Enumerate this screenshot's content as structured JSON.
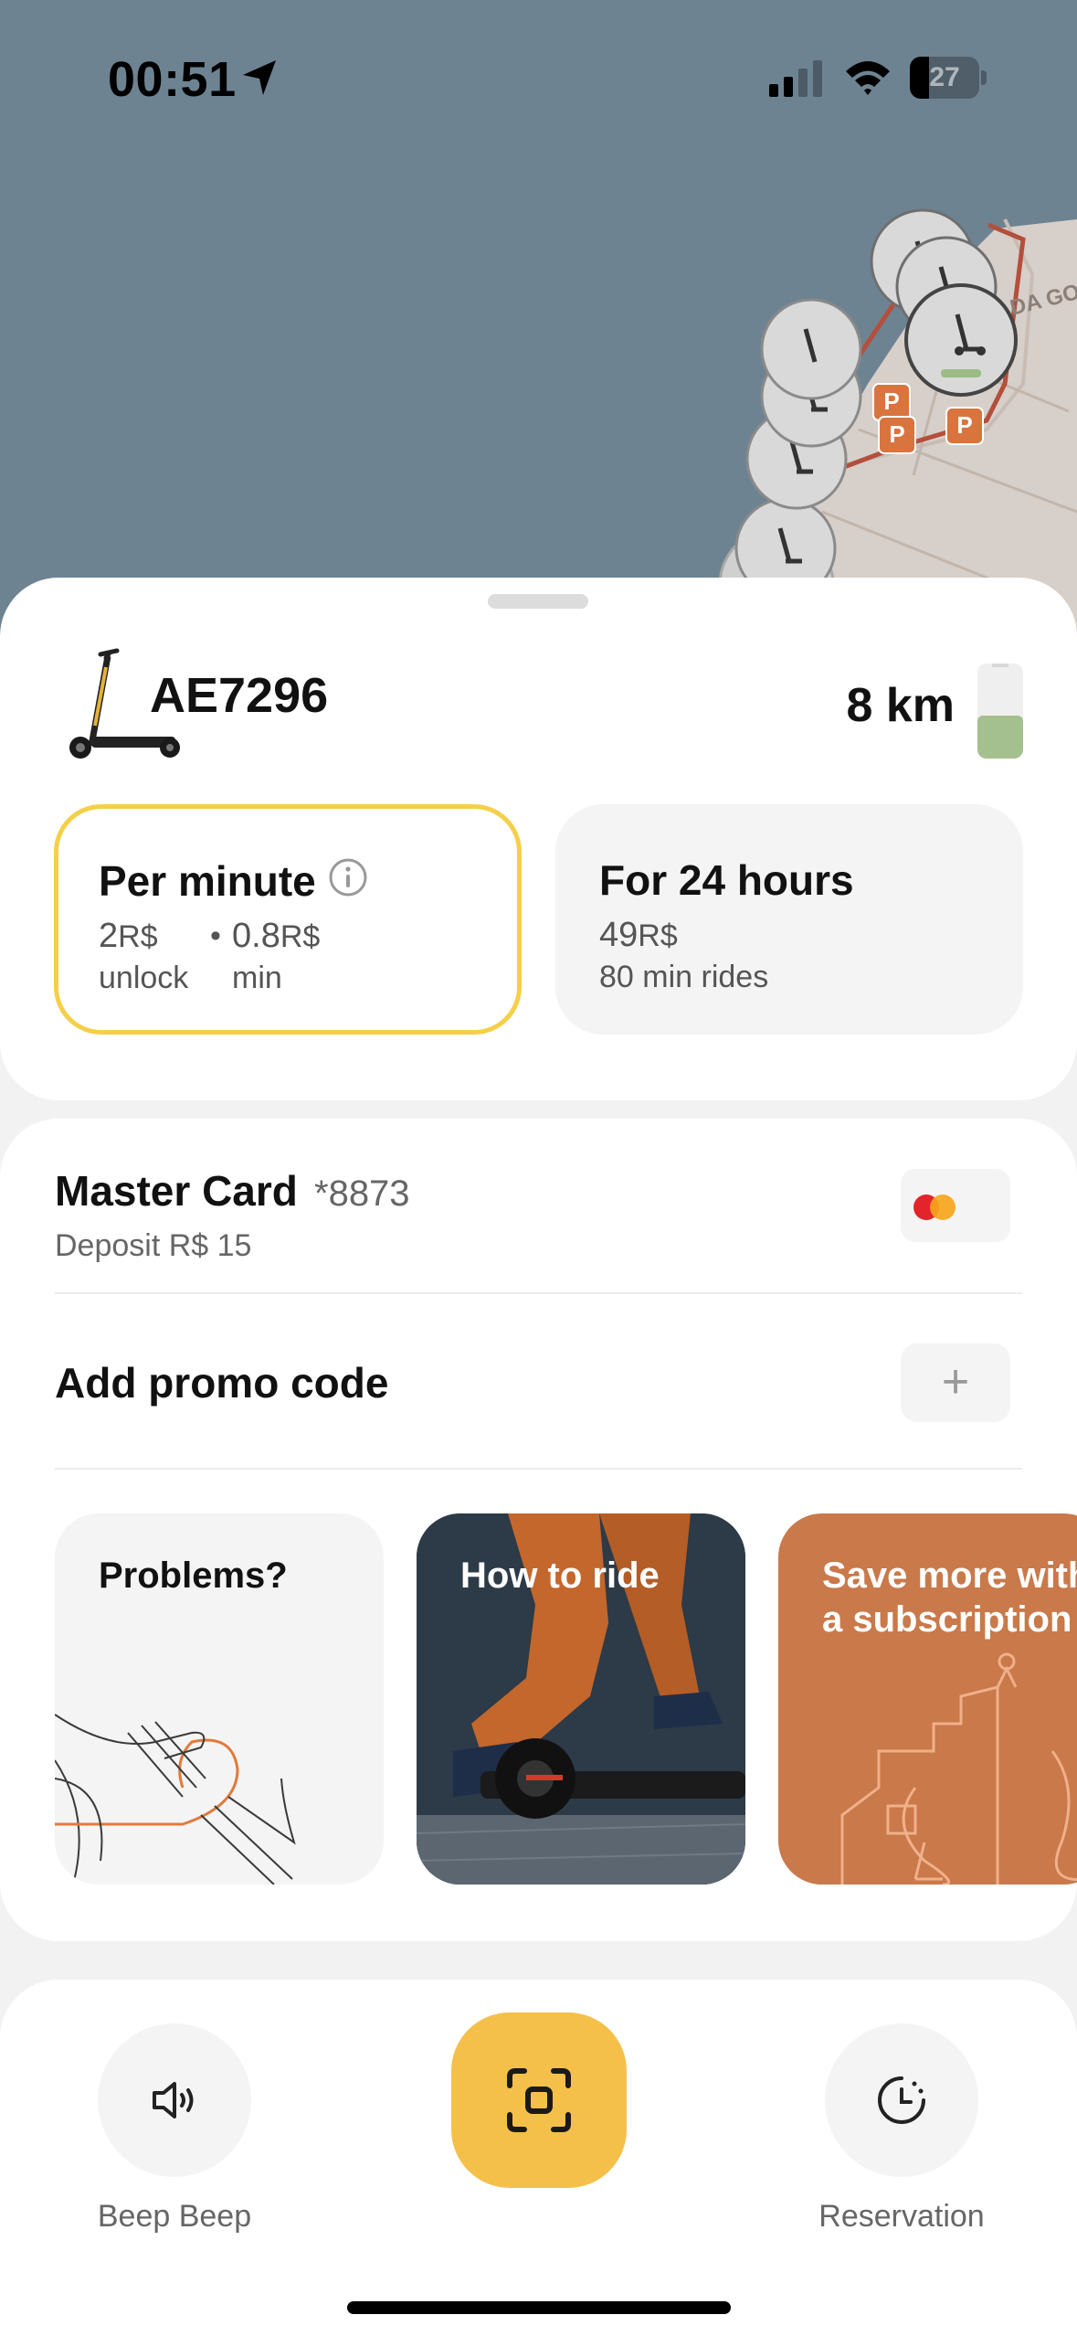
{
  "status_bar": {
    "time": "00:51",
    "battery_level": "27",
    "battery_fraction": 0.27
  },
  "map": {
    "street_label": "DA GO",
    "parking_labels": [
      "P",
      "P",
      "P",
      "P"
    ]
  },
  "vehicle": {
    "id": "AE7296",
    "range": "8 km",
    "battery_fraction": 0.45
  },
  "tariffs": [
    {
      "title": "Per minute",
      "unlock_price": "2",
      "unlock_currency": "R$",
      "unlock_label": "unlock",
      "separator": "•",
      "rate_price": "0.8",
      "rate_currency": "R$",
      "rate_label": "min",
      "selected": true
    },
    {
      "title": "For 24 hours",
      "price": "49",
      "currency": "R$",
      "label": "80 min rides",
      "selected": false
    }
  ],
  "payment": {
    "card_name": "Master Card",
    "card_last4": "*8873",
    "deposit": "Deposit R$ 15",
    "card_icon": "mastercard-icon"
  },
  "promo": {
    "label": "Add promo code",
    "add_symbol": "+"
  },
  "tiles": [
    {
      "title": "Problems?"
    },
    {
      "title": "How to ride"
    },
    {
      "title": "Save more with a subscription"
    }
  ],
  "bottom_bar": {
    "beep_label": "Beep Beep",
    "reservation_label": "Reservation",
    "scan_icon": "scan-icon"
  },
  "colors": {
    "accent_yellow": "#f5c04a",
    "selected_border": "#f5cf49",
    "map_background": "#6e8392",
    "parking_orange": "#d9743f",
    "subscription_tile": "#c9794a"
  }
}
